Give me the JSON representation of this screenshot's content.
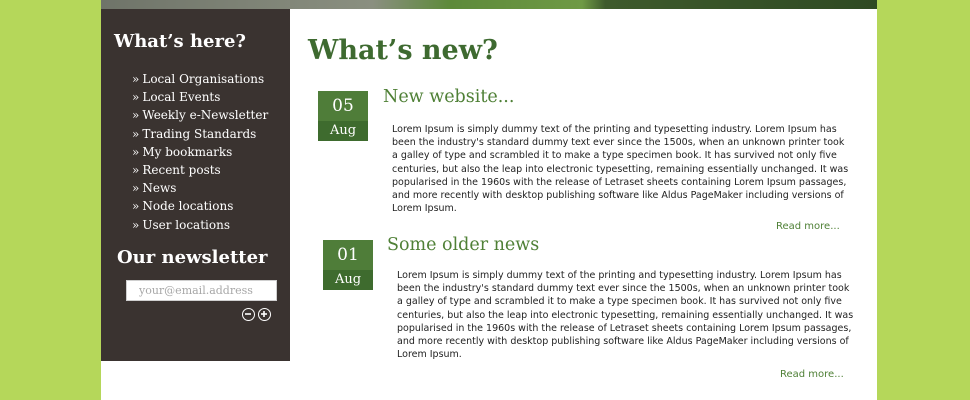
{
  "sidebar": {
    "whats_here_title": "What’s here?",
    "nav_marker": "»",
    "nav_items": [
      "Local Organisations",
      "Local Events",
      "Weekly e-Newsletter",
      "Trading Standards",
      "My bookmarks",
      "Recent posts",
      "News",
      "Node locations",
      "User locations"
    ],
    "newsletter_title": "Our newsletter",
    "newsletter_placeholder": "your@email.address",
    "unsubscribe_icon": "minus-circle-icon",
    "subscribe_icon": "plus-circle-icon"
  },
  "main": {
    "title": "What’s new?",
    "posts": [
      {
        "day": "05",
        "month": "Aug",
        "title": "New website...",
        "body": "Lorem Ipsum is simply dummy text of the printing and typesetting industry. Lorem Ipsum has been the industry's standard dummy text ever since the 1500s, when an unknown printer took a galley of type and scrambled it to make a type specimen book. It has survived not only five centuries, but also the leap into electronic typesetting, remaining essentially unchanged. It was popularised in the 1960s with the release of Letraset sheets containing Lorem Ipsum passages, and more recently with desktop publishing software like Aldus PageMaker including versions of Lorem Ipsum.",
        "read_more": "Read more..."
      },
      {
        "day": "01",
        "month": "Aug",
        "title": "Some older news",
        "body": "Lorem Ipsum is simply dummy text of the printing and typesetting industry. Lorem Ipsum has been the industry's standard dummy text ever since the 1500s, when an unknown printer took a galley of type and scrambled it to make a type specimen book. It has survived not only five centuries, but also the leap into electronic typesetting, remaining essentially unchanged. It was popularised in the 1960s with the release of Letraset sheets containing Lorem Ipsum passages, and more recently with desktop publishing software like Aldus PageMaker including versions of Lorem Ipsum.",
        "read_more": "Read more..."
      }
    ]
  },
  "colors": {
    "background": "#b5d75a",
    "sidebar": "#3a3330",
    "accent_green": "#4f8036",
    "date_box_top": "#4f7d39",
    "date_box_bottom": "#3e6b2e"
  }
}
